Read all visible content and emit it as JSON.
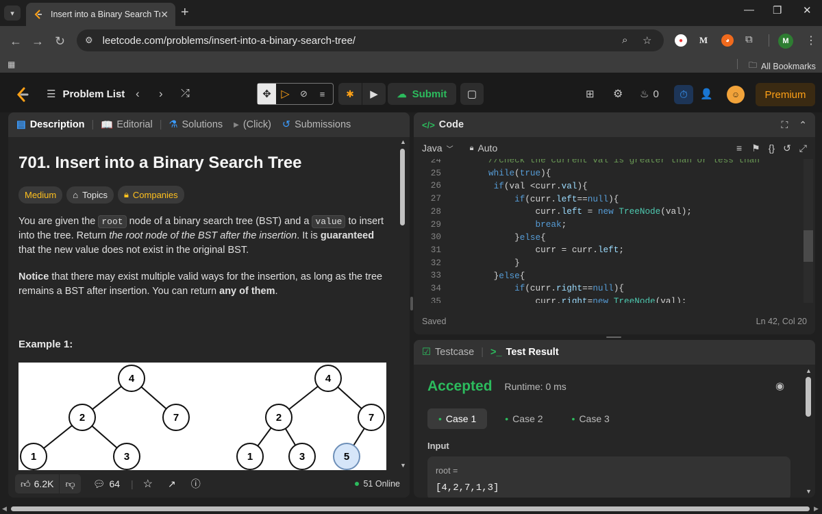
{
  "browser": {
    "tab_title": "Insert into a Binary Search Tree",
    "url": "leetcode.com/problems/insert-into-a-binary-search-tree/",
    "all_bookmarks": "All Bookmarks",
    "profile_initial": "M",
    "medium_ext": "M"
  },
  "header": {
    "problem_list": "Problem List",
    "submit": "Submit",
    "streak": "0",
    "premium": "Premium"
  },
  "left": {
    "tabs": [
      "Description",
      "Editorial",
      "Solutions",
      "(Click)",
      "Submissions"
    ],
    "title": "701. Insert into a Binary Search Tree",
    "badges": [
      "Medium",
      "Topics",
      "Companies"
    ],
    "p1": [
      "You are given the ",
      "root",
      " node of a binary search tree (BST) and a ",
      "value",
      " to insert into the tree. Return ",
      "the root node of the BST after the insertion",
      ". It is ",
      "guaranteed",
      " that the new value does not exist in the original BST."
    ],
    "p2": [
      "Notice",
      " that there may exist multiple valid ways for the insertion, as long as the tree remains a BST after insertion. You can return ",
      "any of them",
      "."
    ],
    "example_title": "Example 1:",
    "tree_left": [
      "4",
      "2",
      "7",
      "1",
      "3"
    ],
    "tree_right": [
      "4",
      "2",
      "7",
      "1",
      "3",
      "5"
    ],
    "likes": "6.2K",
    "comments": "64",
    "online": "51 Online"
  },
  "code": {
    "title": "Code",
    "language": "Java",
    "mode": "Auto",
    "saved": "Saved",
    "cursor": "Ln 42, Col 20",
    "line_numbers": [
      "24",
      "25",
      "26",
      "27",
      "28",
      "29",
      "30",
      "31",
      "32",
      "33",
      "34",
      "35"
    ]
  },
  "test": {
    "tab_testcase": "Testcase",
    "tab_result": "Test Result",
    "status": "Accepted",
    "runtime": "Runtime: 0 ms",
    "cases": [
      "Case 1",
      "Case 2",
      "Case 3"
    ],
    "input_label": "Input",
    "param": "root =",
    "value": "[4,2,7,1,3]"
  },
  "colors": {
    "accepted": "#2cbb5d",
    "medium": "#ffc01e",
    "premium": "#ffa116",
    "timer": "#3b9cff"
  }
}
